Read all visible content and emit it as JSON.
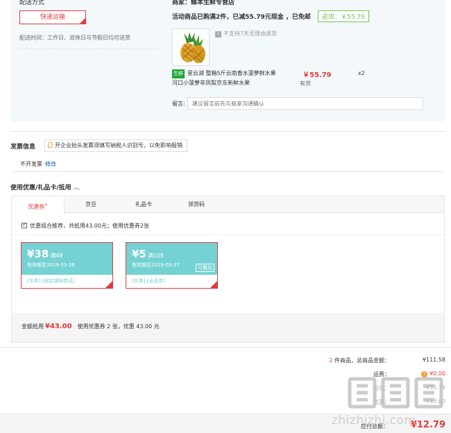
{
  "shipping": {
    "label": "配送方式",
    "method_button": "快递运输",
    "time_note": "配送时间：工作日、双休日与节假日均可送货"
  },
  "order": {
    "merchant": "商家：蝶本生鲜专营店",
    "promo_text": "活动商品已购满2件，已减55.79元现金 ，已免邮",
    "rebate_badge": "返现：￥55.79",
    "no_refund": "不支持7天无理由退货",
    "product": {
      "tag": "生鲜",
      "title": "星云湖 整箱5斤云南香水菠萝鲜水果 河口小菠萝非凤梨京东新鲜水果",
      "price": "￥55.79",
      "stock": "有货",
      "qty": "x2"
    },
    "note_label": "留言:",
    "note_placeholder": "建议留言前先与商家沟通确认"
  },
  "invoice": {
    "title": "发票信息",
    "tip": "开企业抬头发票须填写纳税人识别号，以免影响报销",
    "value": "不开发票",
    "edit_link": "修改"
  },
  "coupons": {
    "title": "使用优惠/礼品卡/抵用",
    "tabs": [
      {
        "label": "优惠券"
      },
      {
        "label": "京豆"
      },
      {
        "label": "礼品卡"
      },
      {
        "label": "领货码"
      }
    ],
    "combo_text": "优惠组合推荐，共抵用43.00元；使用优惠券2张",
    "items": [
      {
        "amount": "¥38",
        "cond": "满48",
        "expiry": "有效期至2019-03-28",
        "scope": "[东券] [限店铺限商品]",
        "stack": ""
      },
      {
        "amount": "¥5",
        "cond": "满105",
        "expiry": "有效期至2019-03-27",
        "scope": "[东券] [全品类]",
        "stack": "可叠加"
      }
    ],
    "amount_label": "金额抵用",
    "amount_value": "¥43.00",
    "amount_detail": "使用优惠券 2 张，优惠 43.00 元"
  },
  "totals": {
    "count_prefix": "2",
    "count_label": "件商品，总商品金额：",
    "goods_total": "¥111.58",
    "freight_label": "运费：",
    "freight_value": "¥0.00",
    "hidden_row1_label": "返现：",
    "hidden_row1_value": "-¥55.79",
    "hidden_row2_label": "优惠：",
    "hidden_row2_value": "-¥43.00",
    "payable_label": "应付总额：",
    "payable_value": "¥12.79"
  },
  "watermark": {
    "text": "zhizhizhi.com"
  },
  "colors": {
    "accent": "#e4393c",
    "coupon": "#74d2d4",
    "fresh": "#1ea63a",
    "rebate": "#7abd54"
  }
}
